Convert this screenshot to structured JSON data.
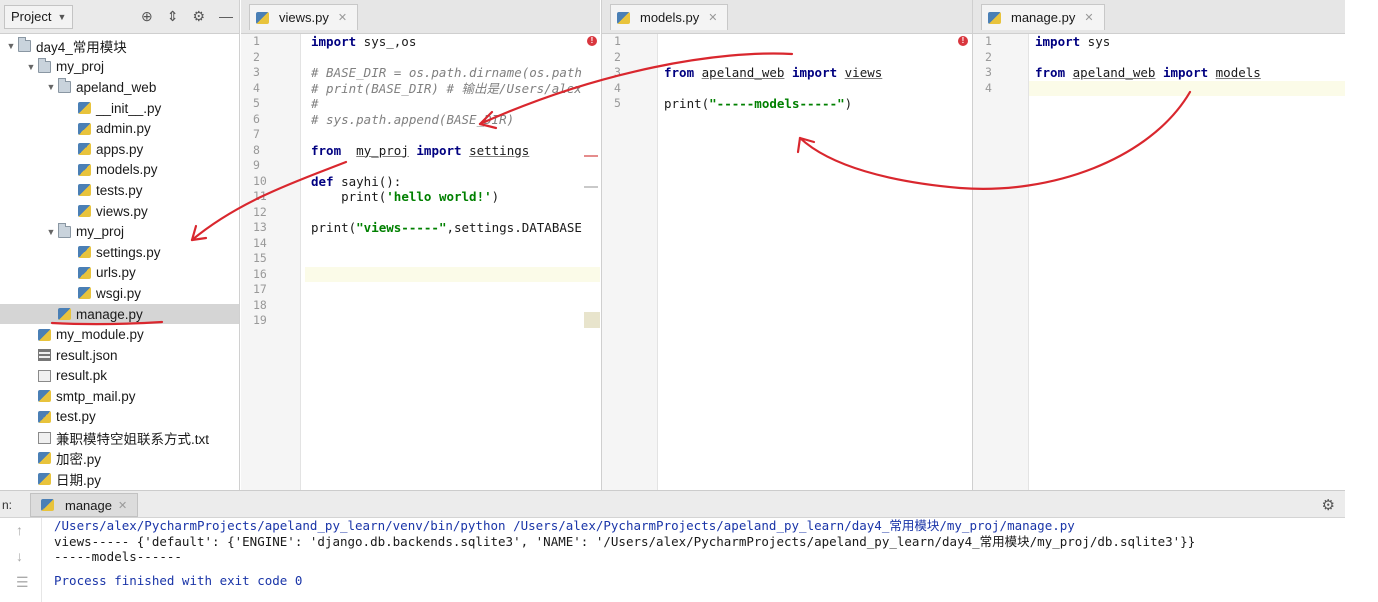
{
  "sidebar": {
    "title": "Project",
    "items": [
      {
        "label": "day4_常用模块",
        "indent": 0,
        "arrow": "▼",
        "icon": "folder"
      },
      {
        "label": "my_proj",
        "indent": 1,
        "arrow": "▼",
        "icon": "folder"
      },
      {
        "label": "apeland_web",
        "indent": 2,
        "arrow": "▼",
        "icon": "folder"
      },
      {
        "label": "__init__.py",
        "indent": 3,
        "arrow": "",
        "icon": "py"
      },
      {
        "label": "admin.py",
        "indent": 3,
        "arrow": "",
        "icon": "py"
      },
      {
        "label": "apps.py",
        "indent": 3,
        "arrow": "",
        "icon": "py"
      },
      {
        "label": "models.py",
        "indent": 3,
        "arrow": "",
        "icon": "py"
      },
      {
        "label": "tests.py",
        "indent": 3,
        "arrow": "",
        "icon": "py"
      },
      {
        "label": "views.py",
        "indent": 3,
        "arrow": "",
        "icon": "py"
      },
      {
        "label": "my_proj",
        "indent": 2,
        "arrow": "▼",
        "icon": "folder"
      },
      {
        "label": "settings.py",
        "indent": 3,
        "arrow": "",
        "icon": "py"
      },
      {
        "label": "urls.py",
        "indent": 3,
        "arrow": "",
        "icon": "py"
      },
      {
        "label": "wsgi.py",
        "indent": 3,
        "arrow": "",
        "icon": "py"
      },
      {
        "label": "manage.py",
        "indent": 2,
        "arrow": "",
        "icon": "py",
        "selected": true
      },
      {
        "label": "my_module.py",
        "indent": 1,
        "arrow": "",
        "icon": "py"
      },
      {
        "label": "result.json",
        "indent": 1,
        "arrow": "",
        "icon": "json"
      },
      {
        "label": "result.pk",
        "indent": 1,
        "arrow": "",
        "icon": "file"
      },
      {
        "label": "smtp_mail.py",
        "indent": 1,
        "arrow": "",
        "icon": "py"
      },
      {
        "label": "test.py",
        "indent": 1,
        "arrow": "",
        "icon": "py"
      },
      {
        "label": "兼职模特空姐联系方式.txt",
        "indent": 1,
        "arrow": "",
        "icon": "file"
      },
      {
        "label": "加密.py",
        "indent": 1,
        "arrow": "",
        "icon": "py"
      },
      {
        "label": "日期.py",
        "indent": 1,
        "arrow": "",
        "icon": "py"
      }
    ]
  },
  "panes": [
    {
      "tab": "views.py",
      "line_numbers": [
        "1",
        "2",
        "3",
        "4",
        "5",
        "6",
        "7",
        "8",
        "9",
        "10",
        "11",
        "12",
        "13",
        "14",
        "15",
        "16",
        "17",
        "18",
        "19"
      ],
      "highlight_line": 16,
      "lines": [
        [
          {
            "t": "import",
            "c": "kw-plain"
          },
          {
            "t": " sys_,os",
            "c": ""
          }
        ],
        [],
        [
          {
            "t": "# BASE_DIR = os.path.dirname(os.path",
            "c": "cm"
          }
        ],
        [
          {
            "t": "# print(BASE_DIR) # 输出是/Users/alex",
            "c": "cm"
          }
        ],
        [
          {
            "t": "#",
            "c": "cm"
          }
        ],
        [
          {
            "t": "# sys.path.append(BASE_DIR)",
            "c": "cm"
          }
        ],
        [],
        [
          {
            "t": "from",
            "c": "kw"
          },
          {
            "t": "  ",
            "c": ""
          },
          {
            "t": "my_proj",
            "c": "ul"
          },
          {
            "t": " ",
            "c": ""
          },
          {
            "t": "import",
            "c": "kw"
          },
          {
            "t": " ",
            "c": ""
          },
          {
            "t": "settings",
            "c": "ul"
          }
        ],
        [],
        [
          {
            "t": "def",
            "c": "kw"
          },
          {
            "t": " sayhi():",
            "c": ""
          }
        ],
        [
          {
            "t": "    print(",
            "c": ""
          },
          {
            "t": "'hello world!'",
            "c": "str"
          },
          {
            "t": ")",
            "c": ""
          }
        ],
        [],
        [
          {
            "t": "print(",
            "c": ""
          },
          {
            "t": "\"views-----\"",
            "c": "str"
          },
          {
            "t": ",settings.DATABASE",
            "c": ""
          }
        ],
        [],
        [],
        [],
        [],
        [],
        []
      ]
    },
    {
      "tab": "models.py",
      "line_numbers": [
        "1",
        "2",
        "3",
        "4",
        "5"
      ],
      "highlight_line": 0,
      "lines": [
        [],
        [],
        [
          {
            "t": "from",
            "c": "kw-plain"
          },
          {
            "t": " ",
            "c": ""
          },
          {
            "t": "apeland_web",
            "c": "ul"
          },
          {
            "t": " ",
            "c": ""
          },
          {
            "t": "import",
            "c": "kw-plain"
          },
          {
            "t": " ",
            "c": ""
          },
          {
            "t": "views",
            "c": "ul"
          }
        ],
        [],
        [
          {
            "t": "print(",
            "c": ""
          },
          {
            "t": "\"-----models-----\"",
            "c": "str"
          },
          {
            "t": ")",
            "c": ""
          }
        ]
      ]
    },
    {
      "tab": "manage.py",
      "line_numbers": [
        "1",
        "2",
        "3",
        "4"
      ],
      "highlight_line": 4,
      "lines": [
        [
          {
            "t": "import",
            "c": "kw-plain"
          },
          {
            "t": " sys",
            "c": ""
          }
        ],
        [],
        [
          {
            "t": "from",
            "c": "kw-plain"
          },
          {
            "t": " ",
            "c": ""
          },
          {
            "t": "apeland_web",
            "c": "ul"
          },
          {
            "t": " ",
            "c": ""
          },
          {
            "t": "import",
            "c": "kw-plain"
          },
          {
            "t": " ",
            "c": ""
          },
          {
            "t": "models",
            "c": "ul"
          }
        ],
        []
      ]
    }
  ],
  "run": {
    "label": "n:",
    "tab": "manage",
    "console": {
      "command": "/Users/alex/PycharmProjects/apeland_py_learn/venv/bin/python /Users/alex/PycharmProjects/apeland_py_learn/day4_常用模块/my_proj/manage.py",
      "output1": "views----- {'default': {'ENGINE': 'django.db.backends.sqlite3', 'NAME': '/Users/alex/PycharmProjects/apeland_py_learn/day4_常用模块/my_proj/db.sqlite3'}}",
      "output2": "-----models------",
      "finished": "Process finished with exit code 0"
    }
  },
  "colors": {
    "annotation": "#d9272e",
    "keyword": "#000080",
    "string": "#008000",
    "comment": "#808080",
    "console_path": "#1a35a8"
  }
}
